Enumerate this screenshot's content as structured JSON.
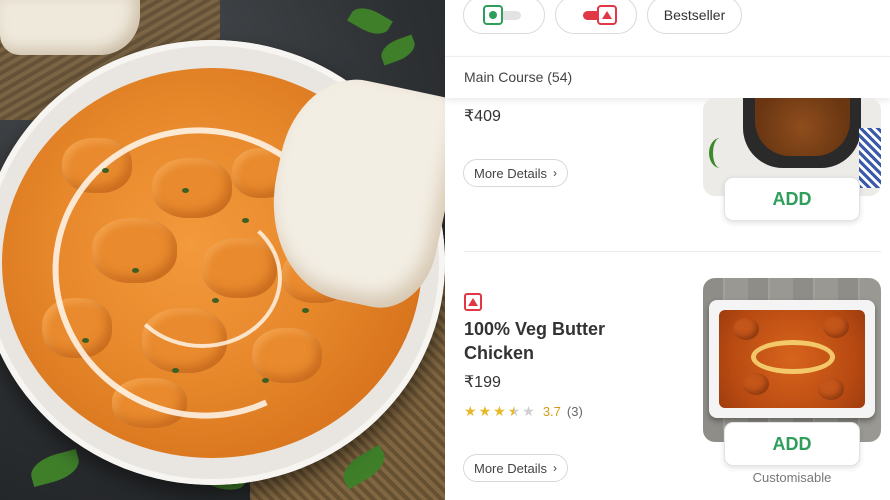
{
  "filters": {
    "veg_toggle": "veg-toggle",
    "nonveg_toggle": "nonveg-toggle",
    "bestseller_label": "Bestseller"
  },
  "section": {
    "title": "Main Course (54)"
  },
  "items": [
    {
      "price": "₹409",
      "more_details": "More Details",
      "add_label": "ADD"
    },
    {
      "name": "100% Veg Butter Chicken",
      "price": "₹199",
      "rating": 3.7,
      "rating_text": "3.7",
      "rating_count": "(3)",
      "more_details": "More Details",
      "add_label": "ADD",
      "customisable": "Customisable"
    }
  ],
  "colors": {
    "accent_green": "#2f9e5b",
    "nonveg_red": "#e23744",
    "star_yellow": "#e9b826"
  }
}
